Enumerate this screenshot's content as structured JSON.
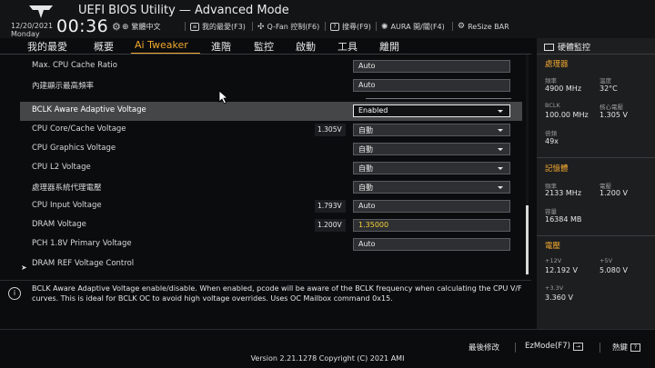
{
  "header": {
    "title": "UEFI BIOS Utility — Advanced Mode",
    "date": "12/20/2021",
    "day": "Monday",
    "time": "00:36",
    "tools": [
      {
        "label": "繁體中文",
        "icon": "globe-icon"
      },
      {
        "label": "我的最愛(F3)",
        "icon": "favorites-icon"
      },
      {
        "label": "Q-Fan 控制(F6)",
        "icon": "fan-icon"
      },
      {
        "label": "搜尋(F9)",
        "icon": "help-search-icon"
      },
      {
        "label": "AURA 開/關(F4)",
        "icon": "aura-icon"
      },
      {
        "label": "ReSize BAR",
        "icon": "resize-bar-icon"
      }
    ]
  },
  "nav": {
    "tabs": [
      "我的最愛",
      "概要",
      "Ai Tweaker",
      "進階",
      "監控",
      "啟動",
      "工具",
      "離開"
    ],
    "active": "Ai Tweaker"
  },
  "settings": [
    {
      "label": "Max. CPU Cache Ratio",
      "value": "Auto",
      "readout": "",
      "dropdown": false
    },
    {
      "label": "內建顯示最高頻率",
      "value": "Auto",
      "readout": "",
      "dropdown": false
    },
    {
      "label": "BCLK Aware Adaptive Voltage",
      "value": "Enabled",
      "readout": "",
      "dropdown": true
    },
    {
      "label": "CPU Core/Cache Voltage",
      "value": "自動",
      "readout": "1.305V",
      "dropdown": true
    },
    {
      "label": "CPU Graphics Voltage",
      "value": "自動",
      "readout": "",
      "dropdown": true
    },
    {
      "label": "CPU L2 Voltage",
      "value": "自動",
      "readout": "",
      "dropdown": true
    },
    {
      "label": "處理器系統代理電壓",
      "value": "自動",
      "readout": "",
      "dropdown": true
    },
    {
      "label": "CPU Input Voltage",
      "value": "Auto",
      "readout": "1.793V",
      "dropdown": false
    },
    {
      "label": "DRAM Voltage",
      "value": "1.35000",
      "readout": "1.200V",
      "dropdown": false
    },
    {
      "label": "PCH 1.8V Primary Voltage",
      "value": "Auto",
      "readout": "",
      "dropdown": false
    },
    {
      "label": "DRAM REF Voltage Control",
      "value": "",
      "readout": "",
      "dropdown": false
    }
  ],
  "help_text": "BCLK Aware Adaptive Voltage enable/disable. When enabled, pcode will be aware of the BCLK frequency when calculating the CPU V/F curves. This is ideal for BCLK OC to avoid high voltage overrides. Uses OC Mailbox command 0x15.",
  "monitor": {
    "title": "硬體監控",
    "cpu": {
      "heading": "處理器",
      "freq_label": "頻率",
      "freq": "4900 MHz",
      "temp_label": "溫度",
      "temp": "32°C",
      "bclk_label": "BCLK",
      "bclk": "100.00 MHz",
      "core_v_label": "核心電壓",
      "core_v": "1.305 V",
      "ratio_label": "倍頻",
      "ratio": "49x"
    },
    "memory": {
      "heading": "記憶體",
      "freq_label": "頻率",
      "freq": "2133 MHz",
      "volt_label": "電壓",
      "volt": "1.200 V",
      "cap_label": "容量",
      "cap": "16384 MB"
    },
    "voltage": {
      "heading": "電壓",
      "v12_label": "+12V",
      "v12": "12.192 V",
      "v5_label": "+5V",
      "v5": "5.080 V",
      "v33_label": "+3.3V",
      "v33": "3.360 V"
    }
  },
  "footer": {
    "version": "Version 2.21.1278 Copyright (C) 2021 AMI",
    "last_modified": "最後修改",
    "ezmode": "EzMode(F7)",
    "hotkeys": "熱鍵",
    "hotkey_symbol": "?"
  },
  "colors": {
    "accent": "#f0a830",
    "selected_row": "#454648",
    "dram_value": "#f3d23a"
  }
}
